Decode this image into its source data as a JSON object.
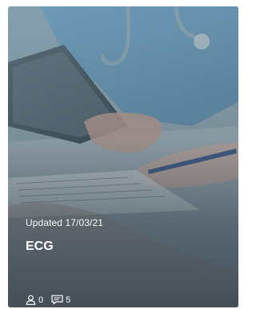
{
  "card": {
    "updated_text": "Updated 17/03/21",
    "title": "ECG",
    "stats": {
      "members_icon": "person-icon",
      "members_count": "0",
      "comments_icon": "comment-icon",
      "comments_count": "5"
    }
  },
  "colors": {
    "overlay_text": "#ffffff",
    "photo_tint": "#7f98a3"
  }
}
